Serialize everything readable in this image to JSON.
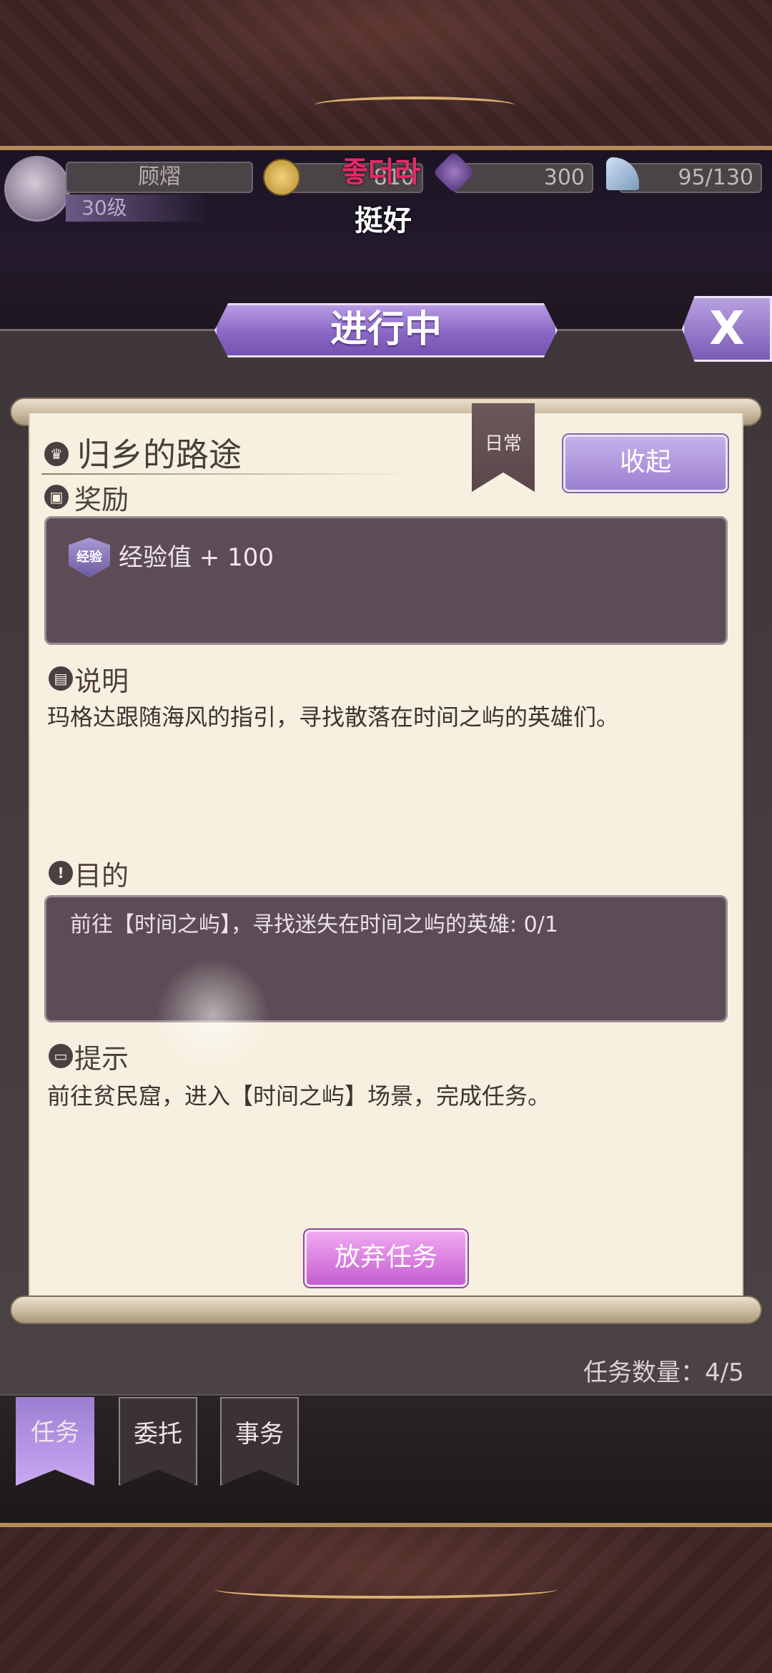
{
  "player": {
    "name": "顾熠",
    "level": "30级"
  },
  "resources": {
    "coins": "810",
    "gems": "300",
    "stamina": "95/130"
  },
  "overlay": {
    "pink_text": "좋더라",
    "white_text": "挺好"
  },
  "dialog": {
    "status": "进行中",
    "close_label": "X"
  },
  "quest": {
    "name": "归乡的路途",
    "category": "日常",
    "collapse_label": "收起",
    "reward_heading": "奖励",
    "reward_badge": "经验",
    "reward_text": "经验值 + 100",
    "description_heading": "说明",
    "description_text": "玛格达跟随海风的指引，寻找散落在时间之屿的英雄们。",
    "goal_heading": "目的",
    "goal_text": "前往【时间之屿】，寻找迷失在时间之屿的英雄: 0/1",
    "hint_heading": "提示",
    "hint_text": "前往贫民窟，进入【时间之屿】场景，完成任务。",
    "abandon_label": "放弃任务"
  },
  "footer": {
    "count_label": "任务数量：4/5"
  },
  "tabs": [
    {
      "label": "任务",
      "active": true
    },
    {
      "label": "委托",
      "active": false
    },
    {
      "label": "事务",
      "active": false
    }
  ],
  "colors": {
    "accent": "#8a67c4",
    "pink_button": "#c65fd0",
    "parchment": "#f7f0e0"
  }
}
